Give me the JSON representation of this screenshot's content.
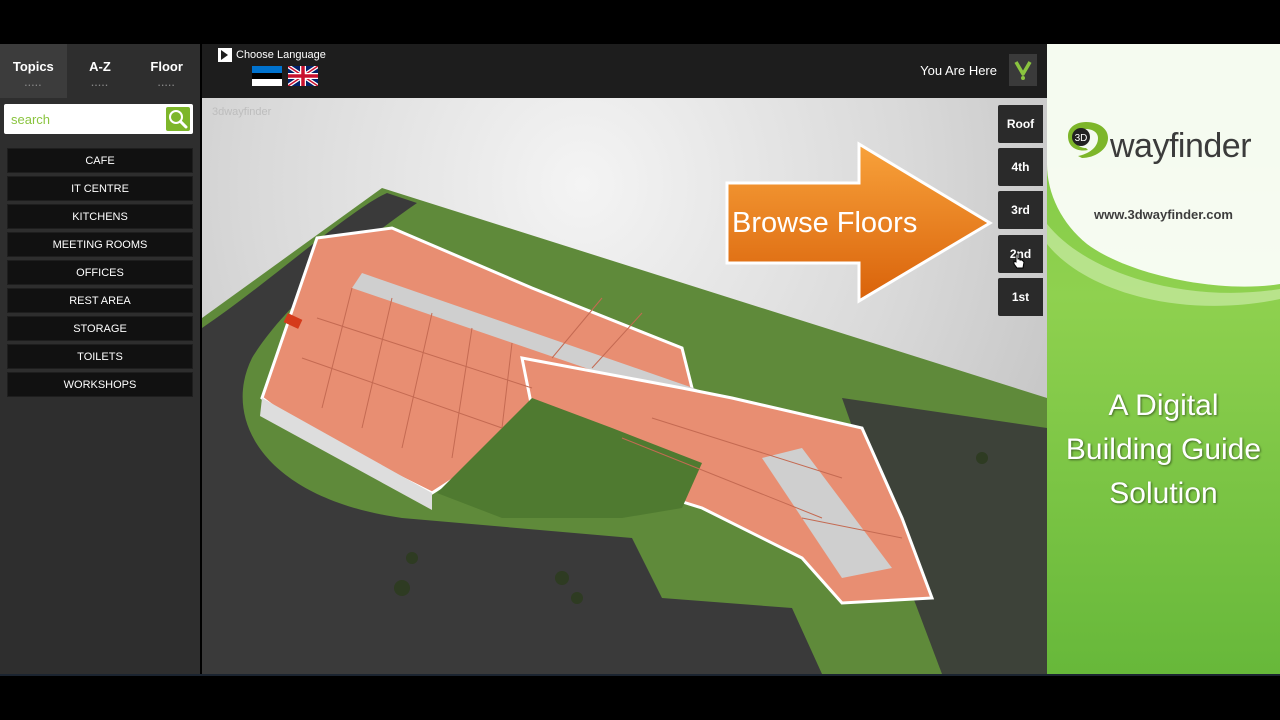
{
  "tabs": [
    {
      "label": "Topics",
      "dots": "....."
    },
    {
      "label": "A-Z",
      "dots": "....."
    },
    {
      "label": "Floor",
      "dots": "....."
    }
  ],
  "search": {
    "placeholder": "search"
  },
  "categories": [
    "CAFE",
    "IT CENTRE",
    "KITCHENS",
    "MEETING ROOMS",
    "OFFICES",
    "REST AREA",
    "STORAGE",
    "TOILETS",
    "WORKSHOPS"
  ],
  "topbar": {
    "choose_language": "Choose Language",
    "you_are_here": "You Are Here",
    "languages": [
      "estonian-flag-icon",
      "uk-flag-icon"
    ]
  },
  "map": {
    "watermark": "3dwayfinder",
    "callout": "Browse Floors"
  },
  "floors": [
    "Roof",
    "4th",
    "3rd",
    "2nd",
    "1st"
  ],
  "promo": {
    "logo_badge": "3D",
    "logo_text": "wayfinder",
    "url": "www.3dwayfinder.com",
    "tagline_lines": [
      "A Digital",
      "Building Guide",
      "Solution"
    ]
  },
  "colors": {
    "accent": "#7db62a",
    "panel": "#2e2e2e",
    "callout": "#f07f18",
    "room": "#e88e72"
  }
}
